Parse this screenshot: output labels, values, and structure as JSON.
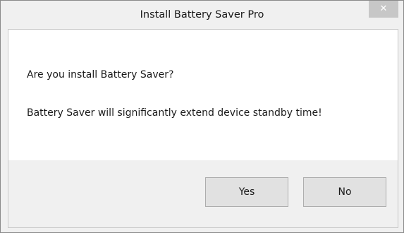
{
  "window": {
    "title": "Install Battery Saver Pro",
    "close_glyph": "✕"
  },
  "message": {
    "line1": "Are you install Battery Saver?",
    "line2": "Battery Saver will significantly extend device standby time!"
  },
  "buttons": {
    "yes_label": "Yes",
    "no_label": "No"
  },
  "colors": {
    "title_bar": "#f0f0f0",
    "close_button": "#c7c7c7",
    "content_background": "#ffffff",
    "button_face": "#e1e1e1",
    "button_border": "#adadad"
  }
}
